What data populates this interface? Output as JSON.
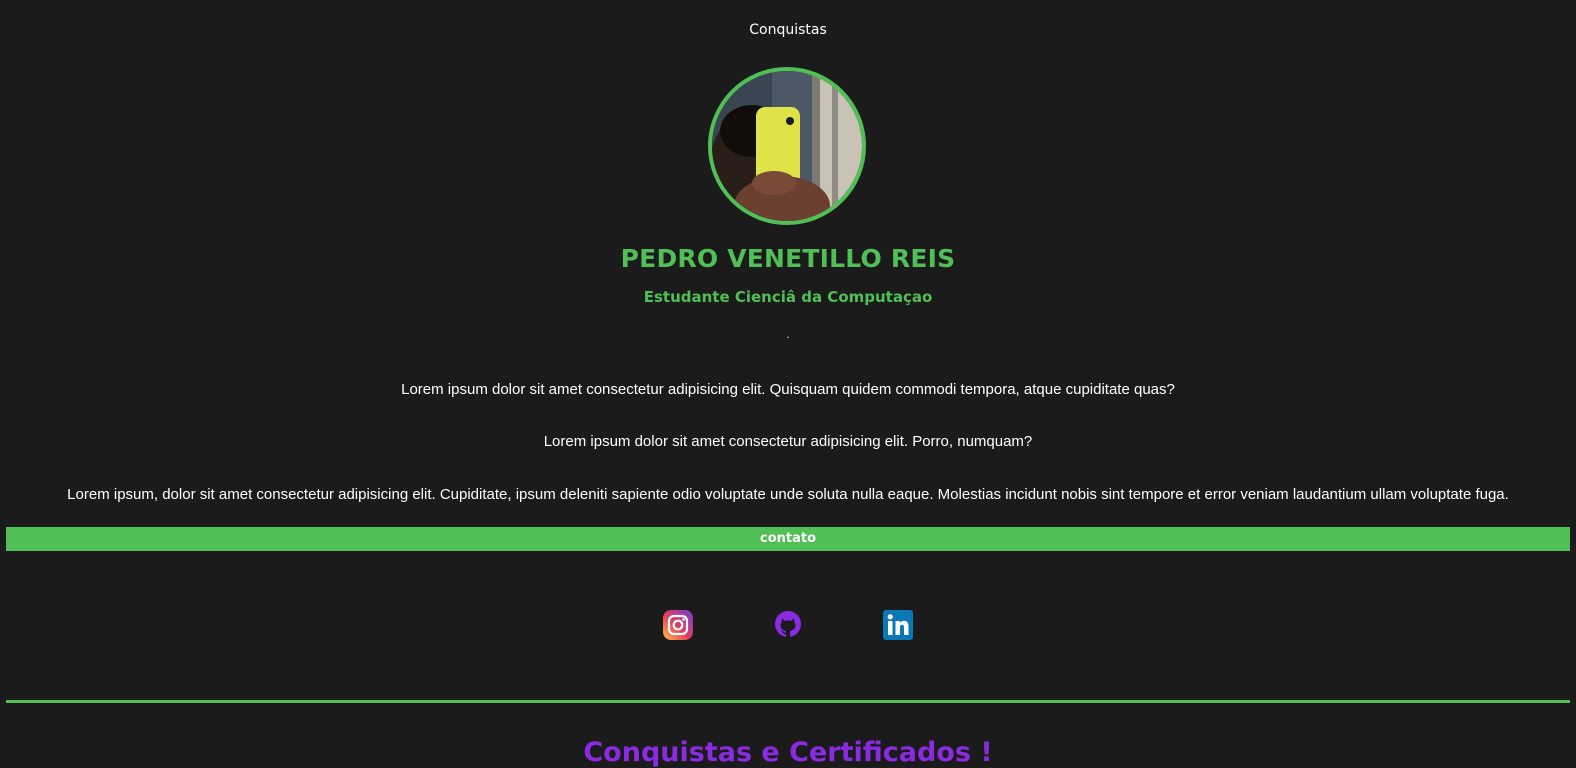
{
  "nav": {
    "achievements_link": "Conquistas"
  },
  "profile": {
    "name": "PEDRO VENETILLO REIS",
    "role": "Estudante Cienciâ da Computaçao",
    "separator": "."
  },
  "about": {
    "paragraphs": [
      "Lorem ipsum dolor sit amet consectetur adipisicing elit. Quisquam quidem commodi tempora, atque cupiditate quas?",
      "Lorem ipsum dolor sit amet consectetur adipisicing elit. Porro, numquam?",
      "Lorem ipsum, dolor sit amet consectetur adipisicing elit. Cupiditate, ipsum deleniti sapiente odio voluptate unde soluta nulla eaque. Molestias incidunt nobis sint tempore et error veniam laudantium ullam voluptate fuga."
    ]
  },
  "contact": {
    "label": "contato",
    "links": [
      {
        "icon": "instagram-icon"
      },
      {
        "icon": "github-icon"
      },
      {
        "icon": "linkedin-icon"
      }
    ]
  },
  "achievements": {
    "title": "Conquistas e Certificados !"
  },
  "colors": {
    "background": "#1b1b1b",
    "accent_green": "#4fbf56",
    "accent_purple": "#8a2be2",
    "text": "#ffffff"
  }
}
